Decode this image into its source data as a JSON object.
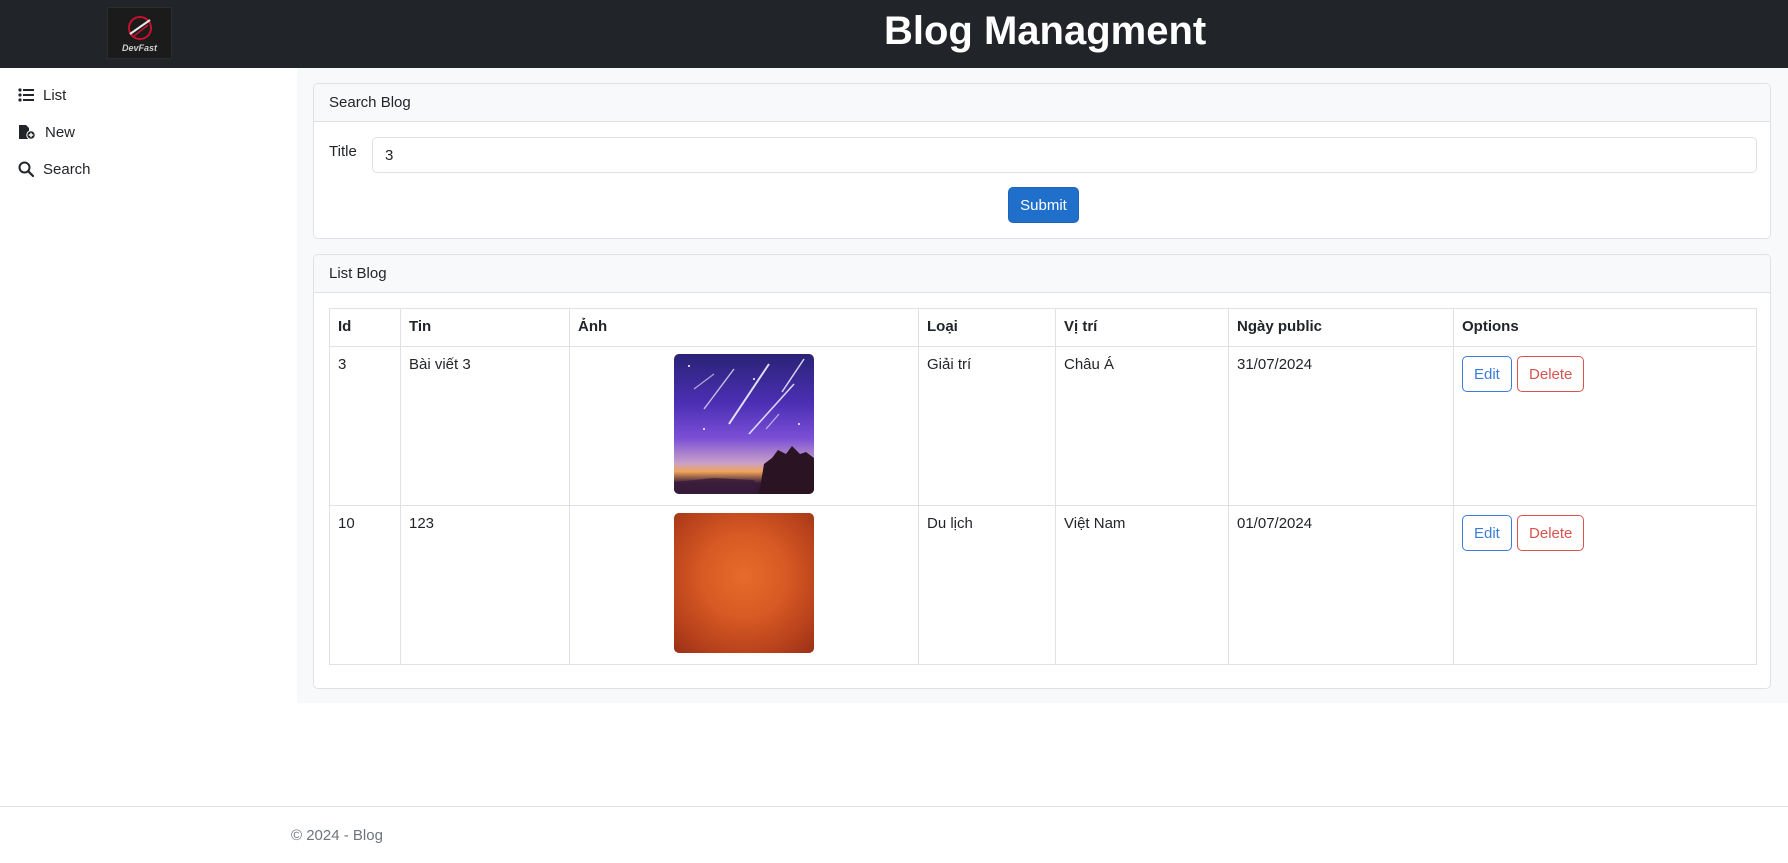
{
  "header": {
    "logo_text": "DevFast",
    "title": "Blog Managment"
  },
  "sidebar": {
    "items": [
      {
        "label": "List",
        "icon": "list-icon"
      },
      {
        "label": "New",
        "icon": "new-file-icon"
      },
      {
        "label": "Search",
        "icon": "search-icon"
      }
    ]
  },
  "search_card": {
    "header": "Search Blog",
    "title_label": "Title",
    "title_value": "3",
    "submit_label": "Submit"
  },
  "list_card": {
    "header": "List Blog",
    "columns": [
      "Id",
      "Tin",
      "Ảnh",
      "Loại",
      "Vị trí",
      "Ngày public",
      "Options"
    ],
    "rows": [
      {
        "id": "3",
        "tin": "Bài viết 3",
        "image": "meteor-night-sky",
        "loai": "Giải trí",
        "vi_tri": "Châu Á",
        "ngay_public": "31/07/2024"
      },
      {
        "id": "10",
        "tin": "123",
        "image": "orange-gradient",
        "loai": "Du lịch",
        "vi_tri": "Việt Nam",
        "ngay_public": "01/07/2024"
      }
    ],
    "edit_label": "Edit",
    "delete_label": "Delete"
  },
  "footer": {
    "text": "© 2024 - Blog"
  },
  "colors": {
    "topbar": "#212529",
    "primary": "#1f6fcb",
    "edit_outline": "#3b7dd8",
    "delete_outline": "#d9534f"
  }
}
